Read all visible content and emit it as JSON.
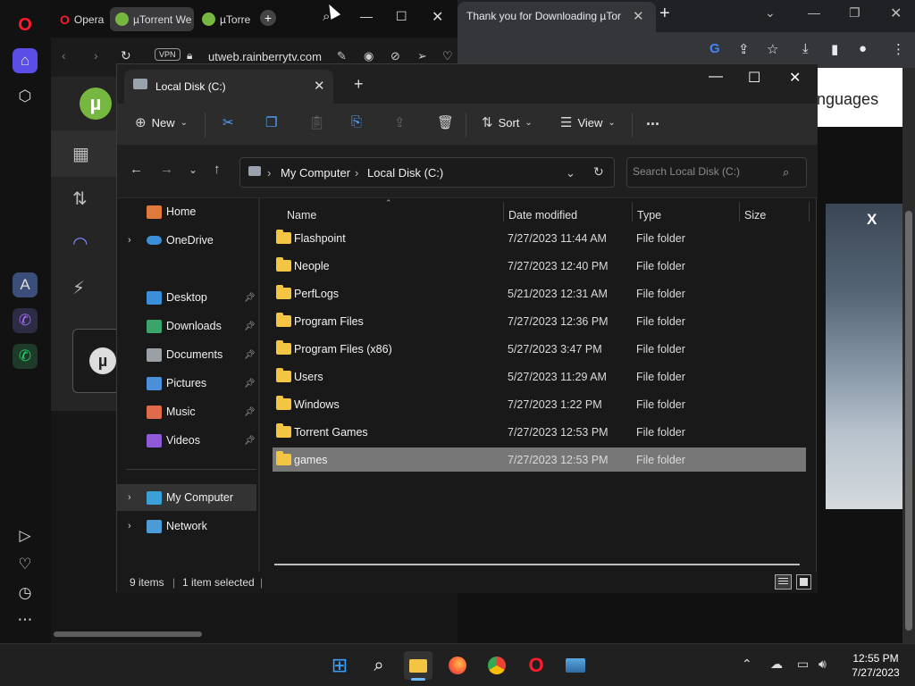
{
  "chrome": {
    "tab_title": "Thank you for Downloading µTor",
    "page_partial_text": "nguages",
    "banner_close": "X"
  },
  "opera": {
    "tabs": [
      "Opera",
      "µTorrent We",
      "µTorre"
    ],
    "url": "utweb.rainberrytv.com",
    "vpn_label": "VPN"
  },
  "explorer": {
    "tab_title": "Local Disk (C:)",
    "commands": {
      "new": "New",
      "sort": "Sort",
      "view": "View",
      "more": "..."
    },
    "breadcrumb": [
      "My Computer",
      "Local Disk (C:)"
    ],
    "search_placeholder": "Search Local Disk (C:)",
    "nav": {
      "home": "Home",
      "onedrive": "OneDrive",
      "quick": [
        {
          "label": "Desktop",
          "color": "#3b8fd8"
        },
        {
          "label": "Downloads",
          "color": "#3aa56b"
        },
        {
          "label": "Documents",
          "color": "#9aa0a6"
        },
        {
          "label": "Pictures",
          "color": "#4a8fd8"
        },
        {
          "label": "Music",
          "color": "#e06b4a"
        },
        {
          "label": "Videos",
          "color": "#8e5ad8"
        }
      ],
      "my_computer": "My Computer",
      "network": "Network"
    },
    "columns": {
      "name": "Name",
      "date": "Date modified",
      "type": "Type",
      "size": "Size"
    },
    "files": [
      {
        "name": "Flashpoint",
        "date": "7/27/2023 11:44 AM",
        "type": "File folder"
      },
      {
        "name": "Neople",
        "date": "7/27/2023 12:40 PM",
        "type": "File folder"
      },
      {
        "name": "PerfLogs",
        "date": "5/21/2023 12:31 AM",
        "type": "File folder"
      },
      {
        "name": "Program Files",
        "date": "7/27/2023 12:36 PM",
        "type": "File folder"
      },
      {
        "name": "Program Files (x86)",
        "date": "5/27/2023 3:47 PM",
        "type": "File folder"
      },
      {
        "name": "Users",
        "date": "5/27/2023 11:29 AM",
        "type": "File folder"
      },
      {
        "name": "Windows",
        "date": "7/27/2023 1:22 PM",
        "type": "File folder"
      },
      {
        "name": "Torrent Games",
        "date": "7/27/2023 12:53 PM",
        "type": "File folder"
      },
      {
        "name": "games",
        "date": "7/27/2023 12:53 PM",
        "type": "File folder"
      }
    ],
    "status": {
      "items": "9 items",
      "selected": "1 item selected"
    }
  },
  "taskbar": {
    "time": "12:55 PM",
    "date": "7/27/2023"
  },
  "colors": {
    "accent": "#6cb8ff",
    "selection": "#777777",
    "folder": "#f4c542",
    "utorrent": "#76b83f",
    "opera": "#ff1b2d"
  }
}
